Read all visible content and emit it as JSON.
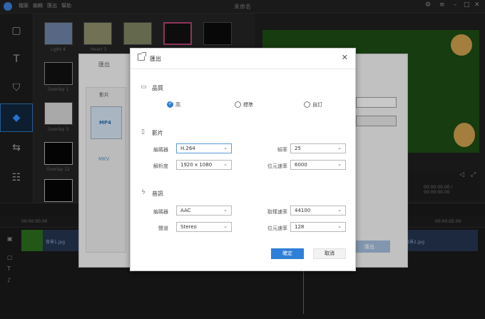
{
  "app": {
    "title": "未命名",
    "menu": [
      "檔案",
      "編輯",
      "匯出",
      "幫助"
    ]
  },
  "library": {
    "items": [
      {
        "label": "Light 4"
      },
      {
        "label": "Heart 3"
      },
      {
        "label": "Overlay 1"
      },
      {
        "label": "Overlay 3"
      },
      {
        "label": "Overlay 12"
      }
    ]
  },
  "preview": {
    "time": "00:00:00.00 / 00:00:00.00"
  },
  "timeline": {
    "ruler_start": "00:00:00.00",
    "ruler_end": "00:00:05.00",
    "clip_left": "背景1.jpg",
    "clip_right": "背景2.jpg"
  },
  "back_dialog": {
    "title": "匯出",
    "tab": "影片",
    "formats": [
      "MP4",
      "MKV"
    ],
    "export_button": "匯出"
  },
  "dialog": {
    "title": "匯出",
    "quality": {
      "title": "品質",
      "options": [
        "高",
        "標準",
        "自訂"
      ],
      "selected": "高"
    },
    "video": {
      "title": "影片",
      "encoder_label": "編碼器",
      "encoder_value": "H.264",
      "framerate_label": "幀率",
      "framerate_value": "25",
      "resolution_label": "解析度",
      "resolution_value": "1920 x 1080",
      "bitrate_label": "位元速率",
      "bitrate_value": "6000"
    },
    "audio": {
      "title": "音訊",
      "encoder_label": "編碼器",
      "encoder_value": "AAC",
      "samplerate_label": "取樣速率",
      "samplerate_value": "44100",
      "channel_label": "聲道",
      "channel_value": "Stereo",
      "bitrate_label": "位元速率",
      "bitrate_value": "128"
    },
    "ok_label": "確定",
    "cancel_label": "取消"
  },
  "colors": {
    "accent": "#2f7fd8",
    "preview_bg": "#1d4a14",
    "dark_bg": "#1e1e1e"
  }
}
